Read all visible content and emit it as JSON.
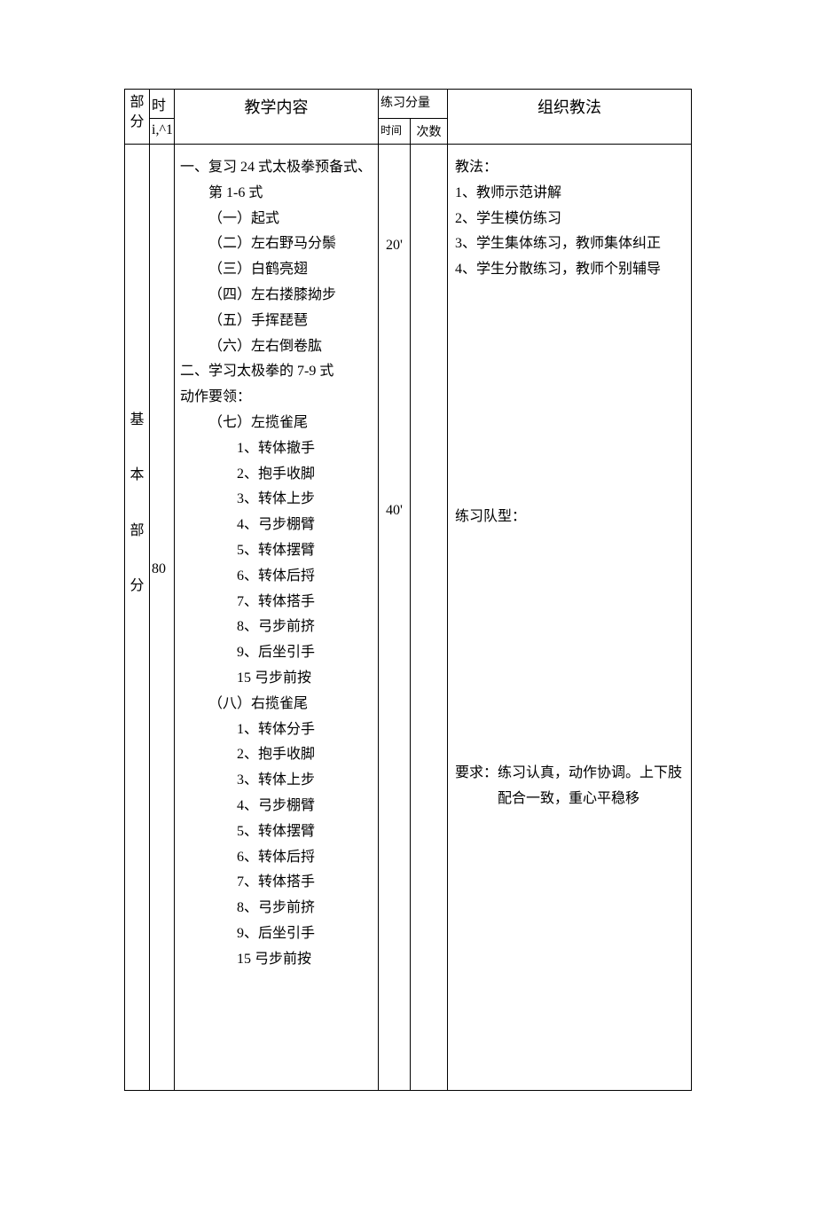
{
  "header": {
    "bufen": "部分",
    "shi": "时",
    "shi2": "i,^1",
    "content_label": "教学内容",
    "fenliang": "练习分量",
    "shijian": "时间",
    "cishu": "次数",
    "method_label": "组织教法"
  },
  "row": {
    "bufen_text": "基本部分",
    "bufen_chars": [
      "基",
      "本",
      "部",
      "分"
    ],
    "shi_value": "80",
    "content": {
      "sec1_title": "一、复习 24 式太极拳预备式、",
      "sec1_sub": "第 1-6 式",
      "s1_items": [
        "（一）起式",
        "（二）左右野马分鬃",
        "（三）白鹤亮翅",
        "（四）左右搂膝拗步",
        "（五）手挥琵琶",
        "（六）左右倒卷肱"
      ],
      "sec2_title": "二、学习太极拳的 7-9 式",
      "sec2_sub": "动作要领：",
      "s2a_head": "（七）左揽雀尾",
      "s2a_items": [
        "1、转体撤手",
        "2、抱手收脚",
        "3、转体上步",
        "4、弓步棚臂",
        "5、转体摆臂",
        "6、转体后捋",
        "7、转体搭手",
        "8、弓步前挤",
        "9、后坐引手",
        "15 弓步前按"
      ],
      "s2b_head": "（八）右揽雀尾",
      "s2b_items": [
        "1、转体分手",
        "2、抱手收脚",
        "3、转体上步",
        "4、弓步棚臂",
        "5、转体摆臂",
        "6、转体后捋",
        "7、转体搭手",
        "8、弓步前挤",
        "9、后坐引手",
        "15 弓步前按"
      ]
    },
    "times": {
      "t1": "20'",
      "t2": "40'"
    },
    "method": {
      "jiaofa_label": "教法：",
      "jiaofa_items": [
        "1、教师示范讲解",
        "2、学生模仿练习",
        "3、学生集体练习，教师集体纠正",
        "4、学生分散练习，教师个别辅导"
      ],
      "duixing_label": "练习队型：",
      "yaoqiu_text": "要求：练习认真，动作协调。上下肢配合一致，重心平稳移"
    }
  }
}
